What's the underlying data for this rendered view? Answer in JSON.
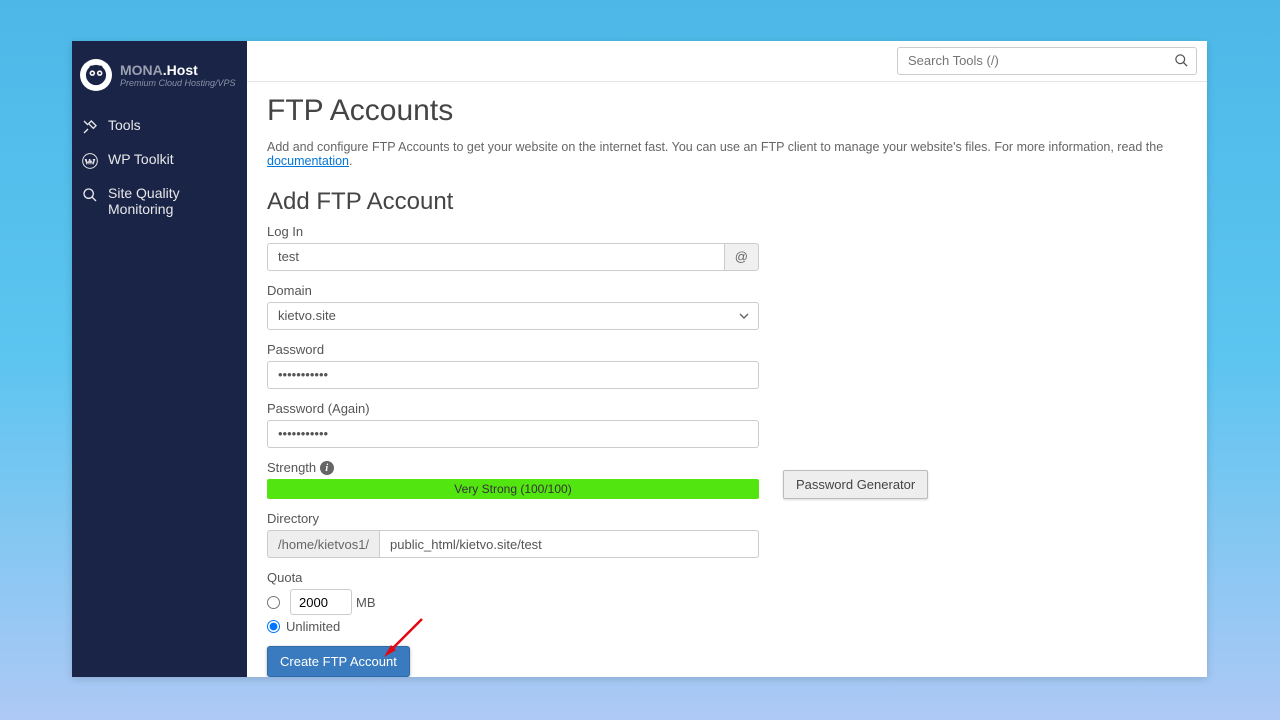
{
  "brand": {
    "name_prefix": "MONA",
    "name_suffix": ".Host",
    "tagline": "Premium Cloud Hosting/VPS"
  },
  "sidebar": {
    "items": [
      {
        "label": "Tools"
      },
      {
        "label": "WP Toolkit"
      },
      {
        "label": "Site Quality Monitoring"
      }
    ]
  },
  "search": {
    "placeholder": "Search Tools (/)"
  },
  "page": {
    "title": "FTP Accounts",
    "desc_prefix": "Add and configure FTP Accounts to get your website on the internet fast. You can use an FTP client to manage your website's files. For more information, read the ",
    "doc_link": "documentation",
    "desc_suffix": "."
  },
  "form": {
    "heading": "Add FTP Account",
    "login_label": "Log In",
    "login_value": "test",
    "at_symbol": "@",
    "domain_label": "Domain",
    "domain_value": "kietvo.site",
    "password_label": "Password",
    "password_value": "•••••••••••",
    "password_again_label": "Password (Again)",
    "password_again_value": "•••••••••••",
    "strength_label": "Strength",
    "strength_text": "Very Strong (100/100)",
    "pw_generator": "Password Generator",
    "directory_label": "Directory",
    "directory_prefix": "/home/kietvos1/",
    "directory_value": "public_html/kietvo.site/test",
    "quota_label": "Quota",
    "quota_value": "2000",
    "quota_unit": "MB",
    "quota_unlimited": "Unlimited",
    "submit": "Create FTP Account"
  }
}
